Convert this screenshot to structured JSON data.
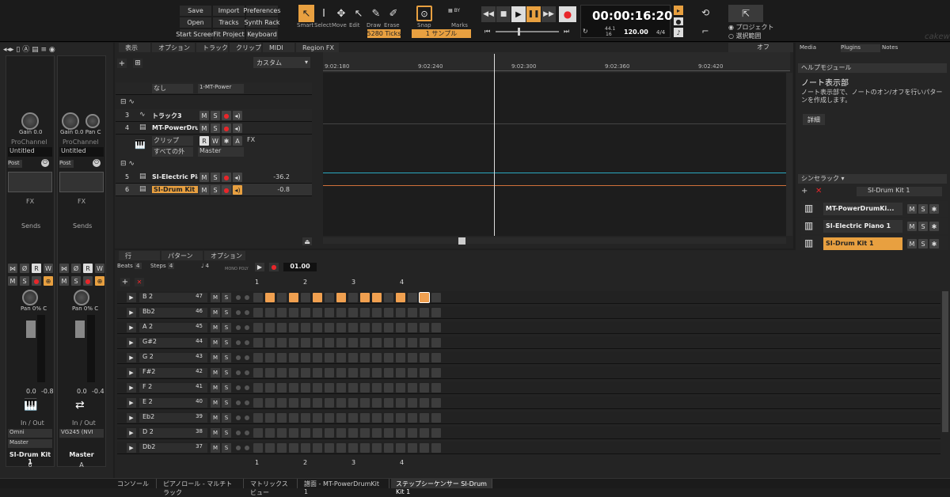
{
  "toolbar": {
    "file_buttons": [
      "Save",
      "Import",
      "Preferences",
      "Open",
      "Tracks",
      "Synth Rack",
      "Start Screen",
      "Fit Project",
      "Keyboard"
    ],
    "tools": [
      "Smart",
      "Select",
      "Move",
      "Edit",
      "Draw",
      "Erase"
    ],
    "snap_value": "5280 Ticks",
    "snap_label": "Snap",
    "marks_label": "Marks",
    "sample_label": "1 サンプル",
    "time": "00:00:16:20",
    "sample_rate": "44.1",
    "bit_depth": "16",
    "tempo": "120.00",
    "meter": "4/4",
    "radio_project": "プロジェクト",
    "radio_selection": "選択範囲",
    "brand": "cakewalk"
  },
  "track_menus": [
    "表示",
    "オプション",
    "トラック",
    "クリップ",
    "MIDI",
    "Region FX"
  ],
  "track_preset": "カスタム",
  "clips_menu": "オフ",
  "timeline": [
    "9:02:180",
    "9:02:240",
    "9:02:300",
    "9:02:360",
    "9:02:420"
  ],
  "tracks": [
    {
      "num": "",
      "name": "",
      "route_a": "なし",
      "route_b": "1-MT-Power"
    },
    {
      "num": "3",
      "name": "トラック3"
    },
    {
      "num": "4",
      "name": "MT-PowerDrum",
      "clip": "クリップ",
      "all": "すべての外",
      "master": "Master",
      "fx": "FX"
    },
    {
      "num": "5",
      "name": "SI-Electric Pian",
      "vol": "-36.2"
    },
    {
      "num": "6",
      "name": "SI-Drum Kit 1",
      "vol": "-0.8"
    }
  ],
  "strip_labels": {
    "gain": "Gain",
    "gain_val": "0.0",
    "pan": "Pan",
    "pan_c": "C",
    "prochannel": "ProChannel",
    "untitled": "Untitled",
    "post": "Post",
    "fx": "FX",
    "sends": "Sends",
    "pan_val": "Pan",
    "pan_pct": "0% C",
    "vol_a": "0.0",
    "vol_b": "-0.8",
    "vol_c": "0.0",
    "vol_d": "-0.4",
    "inout": "In / Out",
    "omni": "Omni",
    "master": "Master",
    "vg": "VG245 (NVI",
    "name1": "SI-Drum Kit 1",
    "name2": "Master",
    "num1": "6",
    "num2": "A"
  },
  "bottom_tabs_left": [
    "Display",
    "Audio",
    "MIDI"
  ],
  "bottom_tabs": [
    "コンソール",
    "ピアノロール - マルチトラック",
    "マトリックスビュー",
    "譜面 - MT-PowerDrumKit 1",
    "ステップシーケンサー SI-Drum Kit 1"
  ],
  "seq_menus": [
    "行",
    "パターン",
    "オプション"
  ],
  "seq_settings": {
    "beats_label": "Beats",
    "beats": "4",
    "steps_label": "Steps",
    "steps": "4",
    "div": "4",
    "mono_poly": "MONO POLY",
    "position": "01.00"
  },
  "beat_numbers": [
    "1",
    "2",
    "3",
    "4"
  ],
  "rows": [
    {
      "note": "B 2",
      "vel": "47",
      "steps": [
        0,
        1,
        0,
        1,
        0,
        1,
        0,
        1,
        0,
        1,
        1,
        0,
        1,
        0,
        1,
        0
      ]
    },
    {
      "note": "Bb2",
      "vel": "46",
      "steps": []
    },
    {
      "note": "A 2",
      "vel": "45",
      "steps": []
    },
    {
      "note": "G#2",
      "vel": "44",
      "steps": []
    },
    {
      "note": "G 2",
      "vel": "43",
      "steps": []
    },
    {
      "note": "F#2",
      "vel": "42",
      "steps": []
    },
    {
      "note": "F 2",
      "vel": "41",
      "steps": []
    },
    {
      "note": "E 2",
      "vel": "40",
      "steps": []
    },
    {
      "note": "Eb2",
      "vel": "39",
      "steps": []
    },
    {
      "note": "D 2",
      "vel": "38",
      "steps": []
    },
    {
      "note": "Db2",
      "vel": "37",
      "steps": []
    }
  ],
  "browser": {
    "tabs": [
      "Media",
      "Plugins",
      "Notes"
    ],
    "help_title": "ヘルプモジュール",
    "help_heading": "ノート表示部",
    "help_text": "ノート表示部で、ノートのオン/オフを行いパターンを作成します。",
    "help_btn": "詳細"
  },
  "synth_rack": {
    "title": "シンセラック",
    "selected": "SI-Drum Kit 1",
    "items": [
      "MT-PowerDrumKi...",
      "SI-Electric Piano 1",
      "SI-Drum Kit 1"
    ]
  },
  "colors": {
    "accent": "#f0a050",
    "record": "#e8262a"
  }
}
